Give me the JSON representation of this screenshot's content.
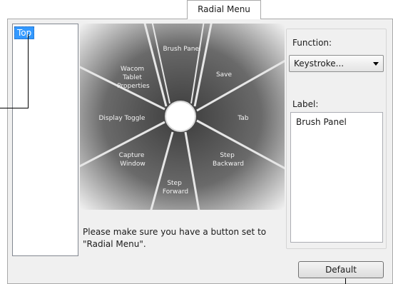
{
  "tab": {
    "label": "Radial Menu"
  },
  "tree": {
    "items": [
      {
        "label": "Top"
      }
    ]
  },
  "radial_menu": {
    "segments": [
      {
        "label": "Brush Panel"
      },
      {
        "label": "Save"
      },
      {
        "label": "Tab"
      },
      {
        "label": "Step Backward"
      },
      {
        "label": "Step Forward"
      },
      {
        "label": "Capture Window"
      },
      {
        "label": "Display Toggle"
      },
      {
        "label": "Wacom Tablet Properties"
      }
    ]
  },
  "note": "Please make sure you have a button set to \"Radial Menu\".",
  "function": {
    "label": "Function:",
    "value": "Keystroke..."
  },
  "label_field": {
    "label": "Label:",
    "value": "Brush Panel"
  },
  "default_button": {
    "label": "Default"
  },
  "colors": {
    "selection": "#3399ff",
    "menu_dark": "#3c3c3c",
    "menu_light": "#f0f0f0"
  }
}
